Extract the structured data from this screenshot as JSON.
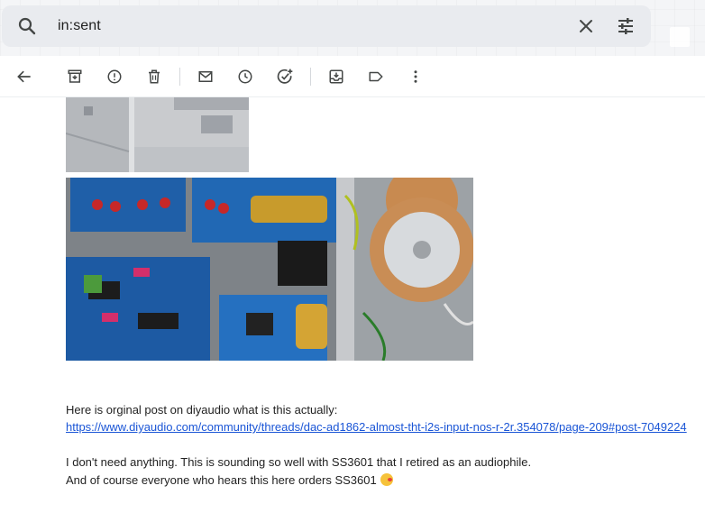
{
  "search": {
    "query": "in:sent"
  },
  "toolbar": {
    "buttons": [
      {
        "name": "back-button",
        "icon": "arrow-back-icon"
      },
      {
        "name": "archive-button",
        "icon": "archive-icon"
      },
      {
        "name": "report-spam-button",
        "icon": "report-icon"
      },
      {
        "name": "delete-button",
        "icon": "trash-icon"
      },
      {
        "name": "mark-unread-button",
        "icon": "mail-icon"
      },
      {
        "name": "snooze-button",
        "icon": "clock-icon"
      },
      {
        "name": "add-task-button",
        "icon": "add-task-icon"
      },
      {
        "name": "move-to-button",
        "icon": "move-to-inbox-icon"
      },
      {
        "name": "label-button",
        "icon": "label-icon"
      },
      {
        "name": "more-button",
        "icon": "more-vert-icon"
      }
    ]
  },
  "message": {
    "intro": "Here is orginal post on diyaudio what is this actually:",
    "link": "https://www.diyaudio.com/community/threads/dac-ad1862-almost-tht-i2s-input-nos-r-2r.354078/page-209#post-7049224",
    "line2": " I don't need anything. This is sounding so well with SS3601 that I retired as an audiophile.",
    "line3": "And of course everyone who hears this here orders SS3601"
  },
  "colors": {
    "icon": "#444746",
    "link": "#1a55d6",
    "searchbar": "#e9ebef"
  }
}
